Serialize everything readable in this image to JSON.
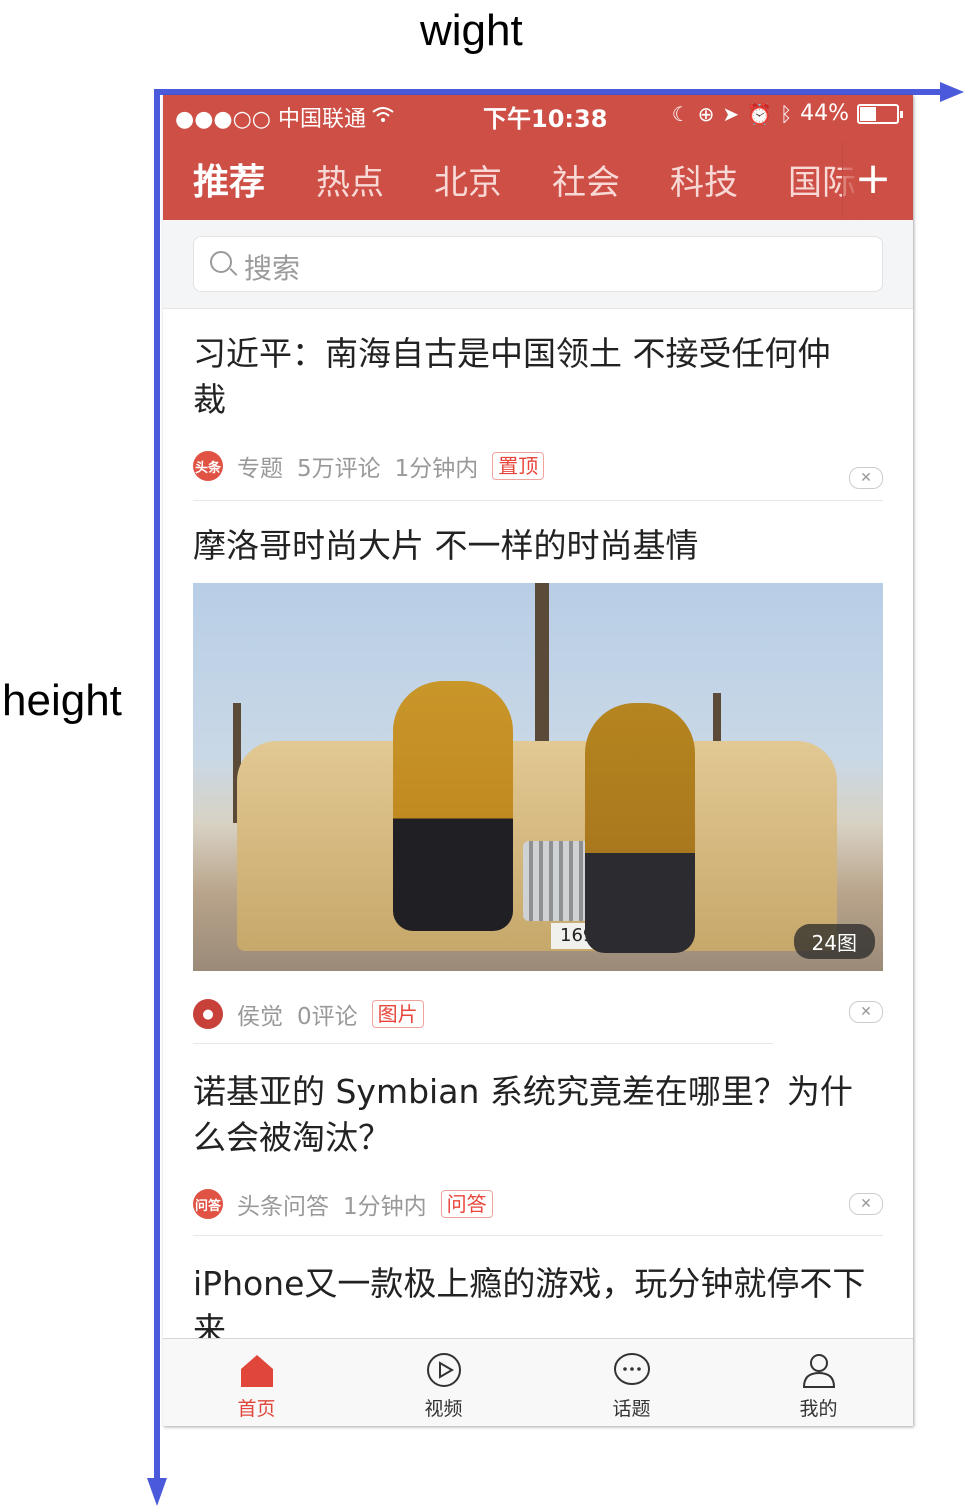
{
  "annotations": {
    "width_label": "wight",
    "height_label": "height"
  },
  "status_bar": {
    "carrier": "●●●○○ 中国联通",
    "time": "下午10:38",
    "battery": "44%",
    "battery_level": 0.44
  },
  "channels": [
    "推荐",
    "热点",
    "北京",
    "社会",
    "科技",
    "国际"
  ],
  "add_channel": "+",
  "search": {
    "placeholder": "搜索"
  },
  "articles": [
    {
      "title": "习近平：南海自古是中国领土 不接受任何仲裁",
      "source_icon": "头条",
      "source": "专题",
      "comments": "5万评论",
      "time": "1分钟内",
      "tag": "置顶"
    },
    {
      "title": "摩洛哥时尚大片 不一样的时尚基情",
      "source": "侯觉",
      "comments": "0评论",
      "tag": "图片",
      "image_count": "24图",
      "plate": "169·11|26"
    },
    {
      "title": "诺基亚的 Symbian 系统究竟差在哪里？为什么会被淘汰？",
      "source_icon": "问答",
      "source": "头条问答",
      "time": "1分钟内",
      "tag": "问答"
    },
    {
      "title": "iPhone又一款极上瘾的游戏，玩分钟就停不下来"
    }
  ],
  "tabbar": [
    "首页",
    "视频",
    "话题",
    "我的"
  ],
  "colors": {
    "brand": "#cd4f46",
    "tag": "#e8463a",
    "axis": "#4a5adb"
  }
}
